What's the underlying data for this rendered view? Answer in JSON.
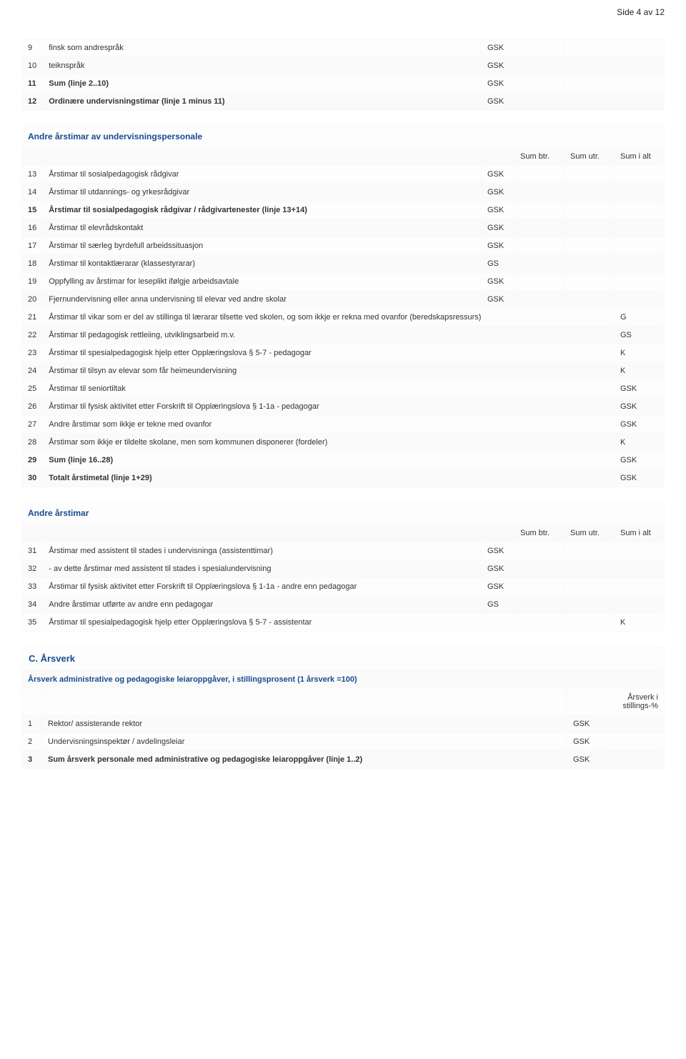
{
  "page": {
    "label": "Side 4 av 12"
  },
  "cols": {
    "sumbtr": "Sum btr.",
    "sumutr": "Sum utr.",
    "sumialt": "Sum i alt"
  },
  "t1": {
    "r9": {
      "n": "9",
      "d": "finsk som andrespråk",
      "c": "GSK"
    },
    "r10": {
      "n": "10",
      "d": "teiknspråk",
      "c": "GSK"
    },
    "r11": {
      "n": "11",
      "d": "Sum (linje 2..10)",
      "c": "GSK"
    },
    "r12": {
      "n": "12",
      "d": "Ordinære undervisningstimar (linje 1 minus 11)",
      "c": "GSK"
    }
  },
  "sectA": {
    "title": "Andre årstimar av undervisningspersonale"
  },
  "t2": {
    "r13": {
      "n": "13",
      "d": "Årstimar til sosialpedagogisk rådgivar",
      "c": "GSK"
    },
    "r14": {
      "n": "14",
      "d": "Årstimar til utdannings- og yrkesrådgivar",
      "c": "GSK"
    },
    "r15": {
      "n": "15",
      "d": "Årstimar til sosialpedagogisk rådgivar / rådgivartenester (linje 13+14)",
      "c": "GSK"
    },
    "r16": {
      "n": "16",
      "d": "Årstimar til elevrådskontakt",
      "c": "GSK"
    },
    "r17": {
      "n": "17",
      "d": "Årstimar til særleg byrdefull arbeidssituasjon",
      "c": "GSK"
    },
    "r18": {
      "n": "18",
      "d": "Årstimar til kontaktlærarar (klassestyrarar)",
      "c": "GS"
    },
    "r19": {
      "n": "19",
      "d": "Oppfylling av årstimar for leseplikt ifølgje arbeidsavtale",
      "c": "GSK"
    },
    "r20": {
      "n": "20",
      "d": "Fjernundervisning eller anna undervisning til elevar ved andre skolar",
      "c": "GSK"
    },
    "r21": {
      "n": "21",
      "d": "Årstimar til vikar som er del av stillinga til lærarar tilsette ved skolen, og som ikkje er rekna med ovanfor (beredskapsressurs)",
      "c": "G"
    },
    "r22": {
      "n": "22",
      "d": "Årstimar til pedagogisk rettleiing, utviklingsarbeid m.v.",
      "c": "GS"
    },
    "r23": {
      "n": "23",
      "d": "Årstimar til spesialpedagogisk hjelp etter Opplæringslova § 5-7 - pedagogar",
      "c": "K"
    },
    "r24": {
      "n": "24",
      "d": "Årstimar til tilsyn av elevar som får heimeundervisning",
      "c": "K"
    },
    "r25": {
      "n": "25",
      "d": "Årstimar til seniortiltak",
      "c": "GSK"
    },
    "r26": {
      "n": "26",
      "d": "Årstimar til fysisk aktivitet etter Forskrift til Opplæringslova § 1-1a - pedagogar",
      "c": "GSK"
    },
    "r27": {
      "n": "27",
      "d": "Andre årstimar som ikkje er tekne med ovanfor",
      "c": "GSK"
    },
    "r28": {
      "n": "28",
      "d": "Årstimar som ikkje er tildelte skolane, men som kommunen disponerer (fordeler)",
      "c": "K"
    },
    "r29": {
      "n": "29",
      "d": "Sum (linje 16..28)",
      "c": "GSK"
    },
    "r30": {
      "n": "30",
      "d": "Totalt årstimetal (linje 1+29)",
      "c": "GSK"
    }
  },
  "sectB": {
    "title": "Andre årstimar"
  },
  "t3": {
    "r31": {
      "n": "31",
      "d": "Årstimar med assistent til stades i undervisninga (assistenttimar)",
      "c": "GSK"
    },
    "r32": {
      "n": "32",
      "d": "- av dette årstimar med assistent til stades i spesialundervisning",
      "c": "GSK"
    },
    "r33": {
      "n": "33",
      "d": "Årstimar til fysisk aktivitet etter Forskrift til Opplæringslova § 1-1a - andre enn pedagogar",
      "c": "GSK"
    },
    "r34": {
      "n": "34",
      "d": "Andre årstimar utførte av andre enn pedagogar",
      "c": "GS"
    },
    "r35": {
      "n": "35",
      "d": "Årstimar til spesialpedagogisk hjelp etter Opplæringslova § 5-7 - assistentar",
      "c": "K"
    }
  },
  "sectC": {
    "heading": "C. Årsverk",
    "title": "Årsverk administrative og pedagogiske leiaroppgåver, i stillingsprosent (1 årsverk =100)",
    "colhead": "Årsverk i stillings-%"
  },
  "t4": {
    "r1": {
      "n": "1",
      "d": "Rektor/ assisterande rektor",
      "c": "GSK"
    },
    "r2": {
      "n": "2",
      "d": "Undervisningsinspektør / avdelingsleiar",
      "c": "GSK"
    },
    "r3": {
      "n": "3",
      "d": "Sum årsverk personale med administrative og pedagogiske leiaroppgåver (linje 1..2)",
      "c": "GSK"
    }
  }
}
